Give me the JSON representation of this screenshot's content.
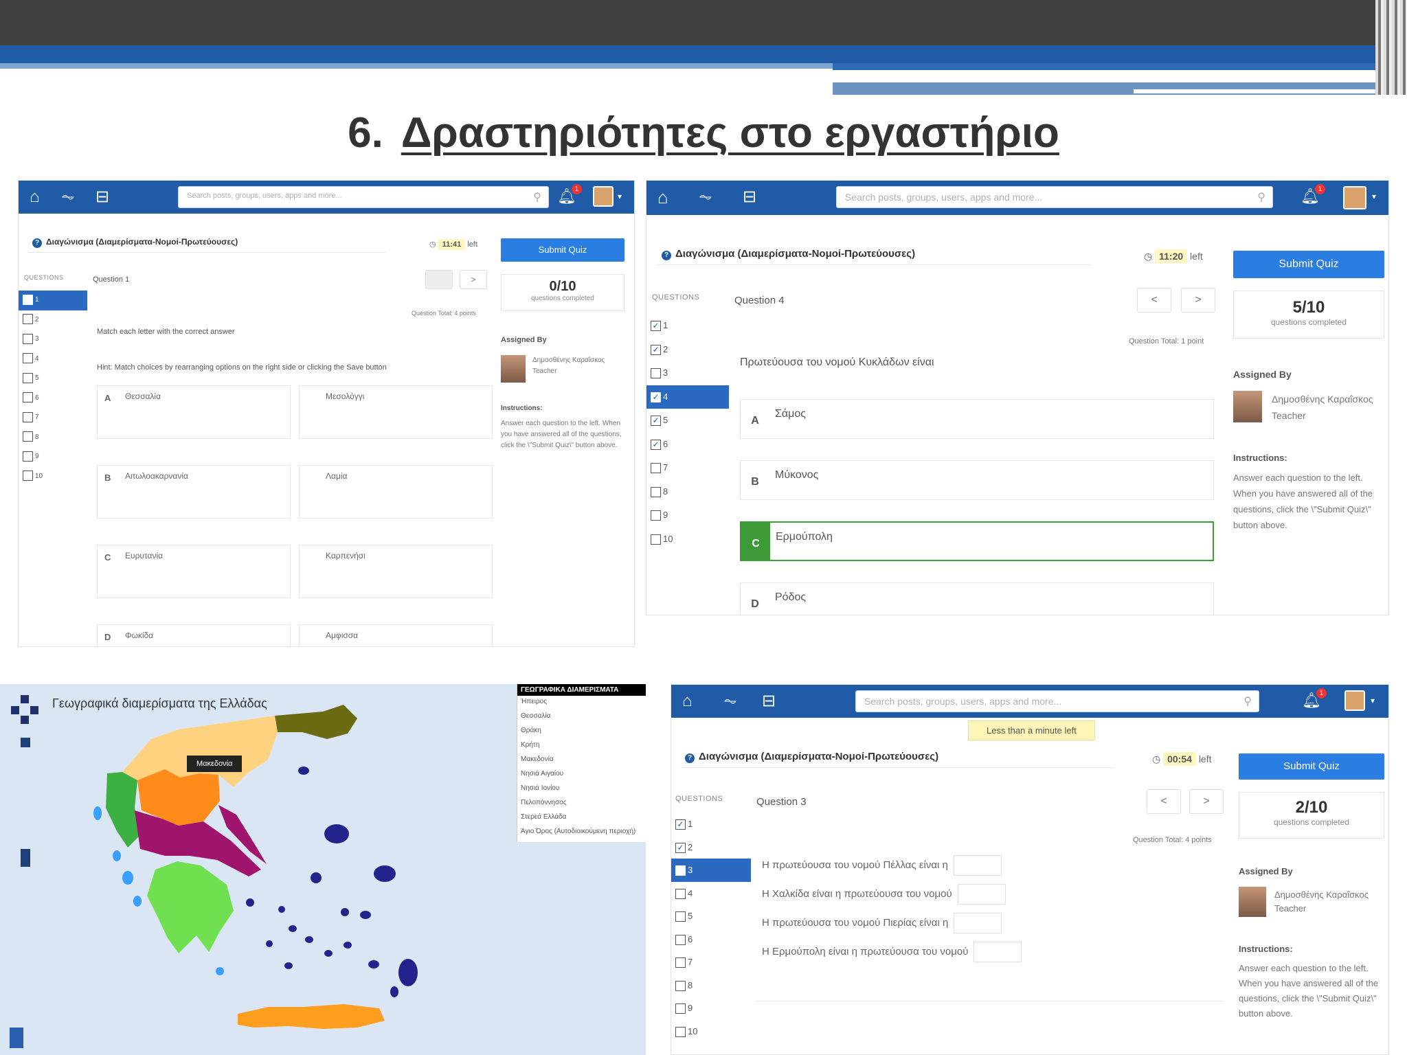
{
  "slide": {
    "number": "6.",
    "title": "Δραστηριότητες στο εργαστήριο"
  },
  "common": {
    "search_placeholder": "Search posts, groups, users, apps and more...",
    "submit_label": "Submit Quiz",
    "questions_header": "QUESTIONS",
    "questions_completed": "questions completed",
    "assigned_by": "Assigned By",
    "teacher_name": "Δημοσθένης Καραΐσκος",
    "teacher_role": "Teacher",
    "instructions_title": "Instructions:",
    "instructions_text": "Answer each question to the left. When you have answered all of the questions, click the \\\"Submit Quiz\\\" button above.",
    "left_label": "left",
    "notification_count": "1",
    "quiz_title": "Διαγώνισμα (Διαμερίσματα-Νομοί-Πρωτεύουσες)",
    "prev": "<",
    "next": ">"
  },
  "shot1": {
    "timer": "11:41",
    "score": "0/10",
    "question_label": "Question 1",
    "question_total": "Question Total: 4 points",
    "instruction": "Match each letter with the correct answer",
    "hint": "Hint: Match choices by rearranging options on the right side or clicking the Save button",
    "questions": [
      "1",
      "2",
      "3",
      "4",
      "5",
      "6",
      "7",
      "8",
      "9",
      "10"
    ],
    "pairs": [
      {
        "letter": "A",
        "left": "Θεσσαλία",
        "right": "Μεσολόγγι"
      },
      {
        "letter": "B",
        "left": "Αιτωλοακαρνανία",
        "right": "Λαμία"
      },
      {
        "letter": "C",
        "left": "Ευρυτανία",
        "right": "Καρπενήσι"
      },
      {
        "letter": "D",
        "left": "Φωκίδα",
        "right": "Αμφισσα"
      }
    ]
  },
  "shot2": {
    "timer": "11:20",
    "score": "5/10",
    "question_label": "Question 4",
    "question_total": "Question Total: 1 point",
    "question_text": "Πρωτεύουσα του νομού Κυκλάδων είναι",
    "questions": [
      "1",
      "2",
      "3",
      "4",
      "5",
      "6",
      "7",
      "8",
      "9",
      "10"
    ],
    "checked": [
      "✓",
      "✓",
      "",
      "✓",
      "✓",
      "✓",
      "",
      "",
      "",
      ""
    ],
    "options": [
      {
        "letter": "A",
        "text": "Σάμος"
      },
      {
        "letter": "B",
        "text": "Μύκονος"
      },
      {
        "letter": "C",
        "text": "Ερμούπολη"
      },
      {
        "letter": "D",
        "text": "Ρόδος"
      }
    ]
  },
  "shot3": {
    "tooltip": "Less than a minute left",
    "timer": "00:54",
    "score": "2/10",
    "question_label": "Question 3",
    "question_total": "Question Total: 4 points",
    "questions": [
      "1",
      "2",
      "3",
      "4",
      "5",
      "6",
      "7",
      "8",
      "9",
      "10"
    ],
    "checked": [
      "✓",
      "✓",
      "",
      "",
      "",
      "",
      "",
      "",
      "",
      ""
    ],
    "fill_rows": [
      "Η πρωτεύουσα του νομού Πέλλας είναι η",
      "Η Χαλκίδα είναι η πρωτεύουσα του νομού",
      "Η πρωτεύουσα του νομού Πιερίας είναι η",
      "Η Ερμούπολη είναι η πρωτεύουσα του νομού"
    ]
  },
  "map": {
    "title": "Γεωγραφικά διαμερίσματα της Ελλάδας",
    "hover_label": "Μακεδονία",
    "legend_title": "ΓΕΩΓΡΑΦΙΚΑ ΔΙΑΜΕΡΙΣΜΑΤΑ",
    "legend_items": [
      "Ήπειρος",
      "Θεσσαλία",
      "Θράκη",
      "Κρήτη",
      "Μακεδονία",
      "Νησιά Αιγαίου",
      "Νησιά Ιονίου",
      "Πελοπόννησος",
      "Στερεά Ελλάδα",
      "Άγιο Όρος (Αυτοδιοικούμενη περιοχή)"
    ],
    "colors": {
      "macedonia": "#ffd27f",
      "thrace": "#6b6b12",
      "epirus": "#3cb043",
      "thessaly": "#ff8c1a",
      "sterea": "#a0146e",
      "peloponnese": "#70e050",
      "islands": "#23238c",
      "ionian": "#3aa0ff",
      "crete": "#ff9e1f"
    }
  },
  "colors": {
    "brand": "#1f5ba6",
    "submit": "#2a7de1",
    "correct": "#3c9b37"
  }
}
